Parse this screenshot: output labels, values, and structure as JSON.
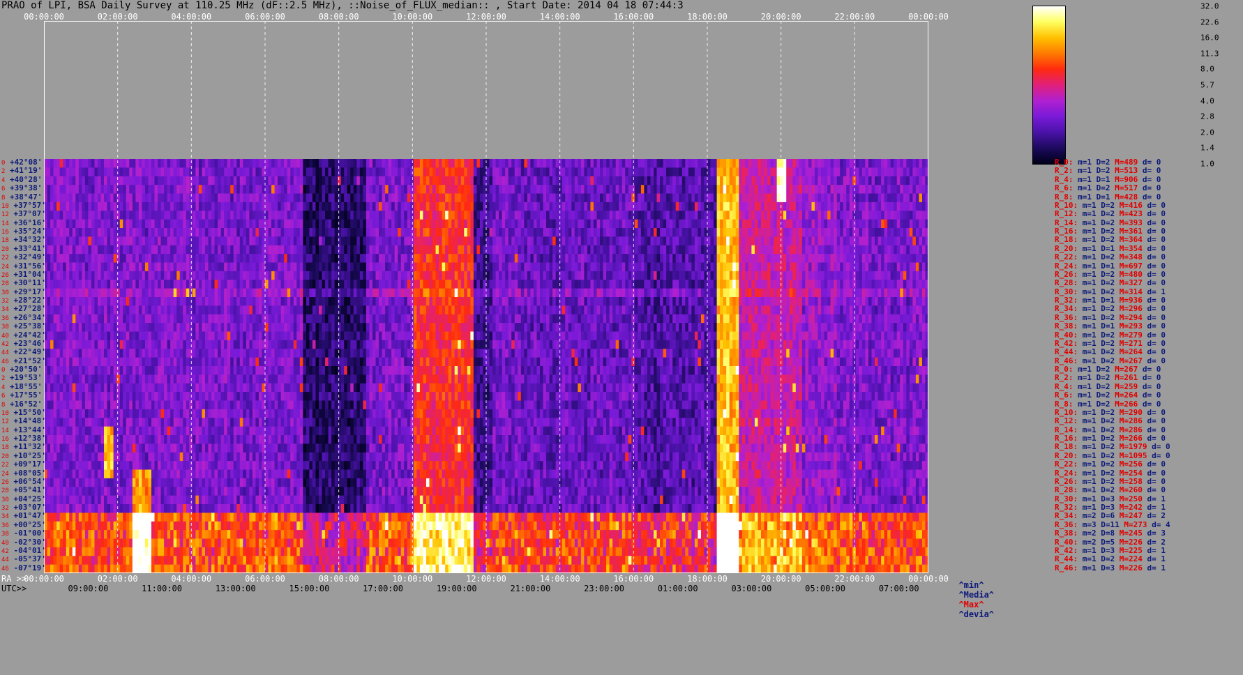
{
  "title": "PRAO of LPI, BSA Daily Survey at 110.25 MHz (dF::2.5 MHz), ::Noise_of_FLUX_median:: , Start Date: 2014 04 18 07:44:3",
  "chart_data": {
    "type": "heatmap",
    "title": "PRAO of LPI, BSA Daily Survey at 110.25 MHz (dF::2.5 MHz), ::Noise_of_FLUX_median:: , Start Date: 2014 04 18 07:44:3",
    "top_ticks": [
      "00:00:00",
      "02:00:00",
      "04:00:00",
      "06:00:00",
      "08:00:00",
      "10:00:00",
      "12:00:00",
      "14:00:00",
      "16:00:00",
      "18:00:00",
      "20:00:00",
      "22:00:00",
      "00:00:00"
    ],
    "ra_label": "RA >>",
    "ra_ticks": [
      "00:00:00",
      "02:00:00",
      "04:00:00",
      "06:00:00",
      "08:00:00",
      "10:00:00",
      "12:00:00",
      "14:00:00",
      "16:00:00",
      "18:00:00",
      "20:00:00",
      "22:00:00",
      "00:00:00"
    ],
    "utc_label": "UTC>>",
    "utc_ticks": [
      "09:00:00",
      "11:00:00",
      "13:00:00",
      "15:00:00",
      "17:00:00",
      "19:00:00",
      "21:00:00",
      "23:00:00",
      "01:00:00",
      "03:00:00",
      "05:00:00",
      "07:00:00"
    ],
    "declinations": [
      "+42°08'",
      "+41°19'",
      "+40°28'",
      "+39°38'",
      "+38°47'",
      "+37°57'",
      "+37°07'",
      "+36°16'",
      "+35°24'",
      "+34°32'",
      "+33°41'",
      "+32°49'",
      "+31°56'",
      "+31°04'",
      "+30°11'",
      "+29°17'",
      "+28°22'",
      "+27°28'",
      "+26°34'",
      "+25°38'",
      "+24°42'",
      "+23°46'",
      "+22°49'",
      "+21°52'",
      "+20°50'",
      "+19°53'",
      "+18°55'",
      "+17°55'",
      "+16°52'",
      "+15°50'",
      "+14°48'",
      "+13°44'",
      "+12°38'",
      "+11°32'",
      "+10°25'",
      "+09°17'",
      "+08°05'",
      "+06°54'",
      "+05°41'",
      "+04°25'",
      "+03°07'",
      "+01°47'",
      "+00°25'",
      "-01°00'",
      "-02°30'",
      "-04°01'",
      "-05°37'",
      "-07°19'"
    ],
    "beam_indices": [
      "0",
      "2",
      "4",
      "6",
      "8",
      "10",
      "12",
      "14",
      "16",
      "18",
      "20",
      "22",
      "24",
      "26",
      "28",
      "30",
      "32",
      "34",
      "36",
      "38",
      "40",
      "42",
      "44",
      "46",
      "0",
      "2",
      "4",
      "6",
      "8",
      "10",
      "12",
      "14",
      "16",
      "18",
      "20",
      "22",
      "24",
      "26",
      "28",
      "30",
      "32",
      "34",
      "36",
      "38",
      "40",
      "42",
      "44",
      "46"
    ],
    "row_stats": [
      {
        "r": "R_0:",
        "m": "m=1",
        "d": "D=2",
        "M": "M=489",
        "dev": "d= 0"
      },
      {
        "r": "R_2:",
        "m": "m=1",
        "d": "D=2",
        "M": "M=513",
        "dev": "d= 0"
      },
      {
        "r": "R_4:",
        "m": "m=1",
        "d": "D=1",
        "M": "M=906",
        "dev": "d= 0"
      },
      {
        "r": "R_6:",
        "m": "m=1",
        "d": "D=2",
        "M": "M=517",
        "dev": "d= 0"
      },
      {
        "r": "R_8:",
        "m": "m=1",
        "d": "D=1",
        "M": "M=428",
        "dev": "d= 0"
      },
      {
        "r": "R_10:",
        "m": "m=1",
        "d": "D=2",
        "M": "M=416",
        "dev": "d= 0"
      },
      {
        "r": "R_12:",
        "m": "m=1",
        "d": "D=2",
        "M": "M=423",
        "dev": "d= 0"
      },
      {
        "r": "R_14:",
        "m": "m=1",
        "d": "D=2",
        "M": "M=393",
        "dev": "d= 0"
      },
      {
        "r": "R_16:",
        "m": "m=1",
        "d": "D=2",
        "M": "M=361",
        "dev": "d= 0"
      },
      {
        "r": "R_18:",
        "m": "m=1",
        "d": "D=2",
        "M": "M=364",
        "dev": "d= 0"
      },
      {
        "r": "R_20:",
        "m": "m=1",
        "d": "D=1",
        "M": "M=354",
        "dev": "d= 0"
      },
      {
        "r": "R_22:",
        "m": "m=1",
        "d": "D=2",
        "M": "M=348",
        "dev": "d= 0"
      },
      {
        "r": "R_24:",
        "m": "m=1",
        "d": "D=1",
        "M": "M=697",
        "dev": "d= 0"
      },
      {
        "r": "R_26:",
        "m": "m=1",
        "d": "D=2",
        "M": "M=480",
        "dev": "d= 0"
      },
      {
        "r": "R_28:",
        "m": "m=1",
        "d": "D=2",
        "M": "M=327",
        "dev": "d= 0"
      },
      {
        "r": "R_30:",
        "m": "m=1",
        "d": "D=2",
        "M": "M=314",
        "dev": "d= 1"
      },
      {
        "r": "R_32:",
        "m": "m=1",
        "d": "D=1",
        "M": "M=936",
        "dev": "d= 0"
      },
      {
        "r": "R_34:",
        "m": "m=1",
        "d": "D=2",
        "M": "M=296",
        "dev": "d= 0"
      },
      {
        "r": "R_36:",
        "m": "m=1",
        "d": "D=2",
        "M": "M=294",
        "dev": "d= 0"
      },
      {
        "r": "R_38:",
        "m": "m=1",
        "d": "D=1",
        "M": "M=293",
        "dev": "d= 0"
      },
      {
        "r": "R_40:",
        "m": "m=1",
        "d": "D=2",
        "M": "M=279",
        "dev": "d= 0"
      },
      {
        "r": "R_42:",
        "m": "m=1",
        "d": "D=2",
        "M": "M=271",
        "dev": "d= 0"
      },
      {
        "r": "R_44:",
        "m": "m=1",
        "d": "D=2",
        "M": "M=264",
        "dev": "d= 0"
      },
      {
        "r": "R_46:",
        "m": "m=1",
        "d": "D=2",
        "M": "M=267",
        "dev": "d= 0"
      },
      {
        "r": "R_0:",
        "m": "m=1",
        "d": "D=2",
        "M": "M=267",
        "dev": "d= 0"
      },
      {
        "r": "R_2:",
        "m": "m=1",
        "d": "D=2",
        "M": "M=261",
        "dev": "d= 0"
      },
      {
        "r": "R_4:",
        "m": "m=1",
        "d": "D=2",
        "M": "M=259",
        "dev": "d= 0"
      },
      {
        "r": "R_6:",
        "m": "m=1",
        "d": "D=2",
        "M": "M=264",
        "dev": "d= 0"
      },
      {
        "r": "R_8:",
        "m": "m=1",
        "d": "D=2",
        "M": "M=266",
        "dev": "d= 0"
      },
      {
        "r": "R_10:",
        "m": "m=1",
        "d": "D=2",
        "M": "M=290",
        "dev": "d= 0"
      },
      {
        "r": "R_12:",
        "m": "m=1",
        "d": "D=2",
        "M": "M=286",
        "dev": "d= 0"
      },
      {
        "r": "R_14:",
        "m": "m=1",
        "d": "D=2",
        "M": "M=286",
        "dev": "d= 0"
      },
      {
        "r": "R_16:",
        "m": "m=1",
        "d": "D=2",
        "M": "M=266",
        "dev": "d= 0"
      },
      {
        "r": "R_18:",
        "m": "m=1",
        "d": "D=2",
        "M": "M=1979",
        "dev": "d= 0"
      },
      {
        "r": "R_20:",
        "m": "m=1",
        "d": "D=2",
        "M": "M=1095",
        "dev": "d= 0"
      },
      {
        "r": "R_22:",
        "m": "m=1",
        "d": "D=2",
        "M": "M=256",
        "dev": "d= 0"
      },
      {
        "r": "R_24:",
        "m": "m=1",
        "d": "D=2",
        "M": "M=254",
        "dev": "d= 0"
      },
      {
        "r": "R_26:",
        "m": "m=1",
        "d": "D=2",
        "M": "M=258",
        "dev": "d= 0"
      },
      {
        "r": "R_28:",
        "m": "m=1",
        "d": "D=2",
        "M": "M=260",
        "dev": "d= 0"
      },
      {
        "r": "R_30:",
        "m": "m=1",
        "d": "D=3",
        "M": "M=250",
        "dev": "d= 1"
      },
      {
        "r": "R_32:",
        "m": "m=1",
        "d": "D=3",
        "M": "M=242",
        "dev": "d= 1"
      },
      {
        "r": "R_34:",
        "m": "m=2",
        "d": "D=6",
        "M": "M=247",
        "dev": "d= 2"
      },
      {
        "r": "R_36:",
        "m": "m=3",
        "d": "D=11",
        "M": "M=273",
        "dev": "d= 4"
      },
      {
        "r": "R_38:",
        "m": "m=2",
        "d": "D=8",
        "M": "M=245",
        "dev": "d= 3"
      },
      {
        "r": "R_40:",
        "m": "m=2",
        "d": "D=5",
        "M": "M=226",
        "dev": "d= 2"
      },
      {
        "r": "R_42:",
        "m": "m=1",
        "d": "D=3",
        "M": "M=225",
        "dev": "d= 1"
      },
      {
        "r": "R_44:",
        "m": "m=1",
        "d": "D=2",
        "M": "M=224",
        "dev": "d= 1"
      },
      {
        "r": "R_46:",
        "m": "m=1",
        "d": "D=3",
        "M": "M=226",
        "dev": "d= 1"
      }
    ],
    "stat_legend": {
      "min": "^min^",
      "media": "^Media^",
      "max": "^Max^",
      "devia": "^devia^"
    },
    "colorbar": {
      "ticks": [
        "32.0",
        "22.6",
        "16.0",
        "11.3",
        "8.0",
        "5.7",
        "4.0",
        "2.8",
        "2.0",
        "1.4",
        "1.0"
      ],
      "range": [
        1.0,
        32.0
      ],
      "scale": "log",
      "colors": [
        "#000018",
        "#1c0a5c",
        "#4a12a8",
        "#7a1ad8",
        "#b020d0",
        "#e0207a",
        "#ff2a10",
        "#ff7a00",
        "#ffc000",
        "#ffff60",
        "#ffffff"
      ]
    },
    "x_range_hours": [
      0,
      24
    ],
    "rows": 48
  }
}
